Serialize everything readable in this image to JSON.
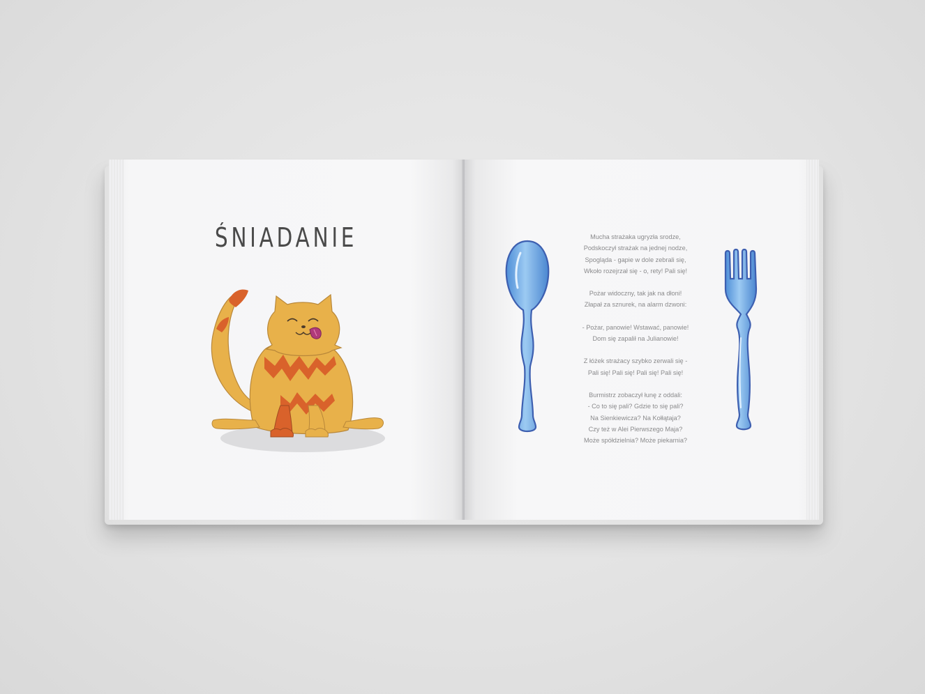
{
  "left_page": {
    "title": "ŚNIADANIE",
    "illustration": "cat-licking-lips"
  },
  "right_page": {
    "illustrations": [
      "spoon",
      "fork"
    ],
    "poem": [
      [
        "Mucha strażaka ugryzła srodze,",
        "Podskoczył strażak na jednej nodze,",
        "Spogląda - gapie w dole zebrali się,",
        "Wkoło rozejrzał się - o, rety! Pali się!"
      ],
      [
        "Pożar widoczny, tak jak na dłoni!",
        "Złapał za sznurek, na alarm dzwoni:"
      ],
      [
        "- Pożar, panowie! Wstawać, panowie!",
        "Dom się zapalił na Julianowie!"
      ],
      [
        "Z łóżek strażacy szybko zerwali się -",
        "Pali się! Pali się! Pali się! Pali się!"
      ],
      [
        "Burmistrz zobaczył łunę z oddali:",
        "- Co to się pali? Gdzie to się pali?",
        "Na Sienkiewicza? Na Kołłątaja?",
        "Czy też w Alei Pierwszego Maja?",
        "Może spółdzielnia? Może piekarnia?"
      ]
    ]
  },
  "colors": {
    "background": "#e4e4e4",
    "page": "#f6f6f7",
    "cat_fur": "#e8b14a",
    "cat_stripes": "#d9622b",
    "cutlery": "#7fb3e8"
  }
}
